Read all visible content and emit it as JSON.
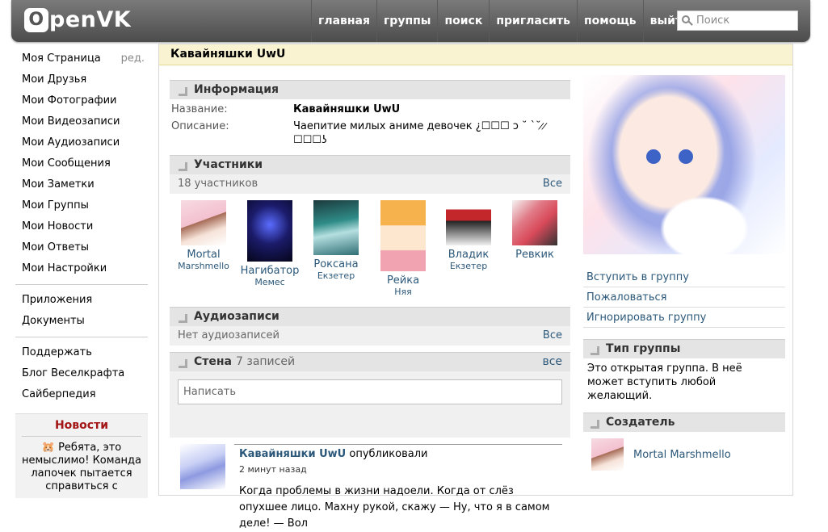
{
  "header": {
    "logo": "penVK",
    "logo_letter": "O",
    "nav": [
      "главная",
      "группы",
      "поиск",
      "пригласить",
      "помощь",
      "выйти"
    ],
    "search_placeholder": "Поиск"
  },
  "sidebar": {
    "items_1": [
      {
        "label": "Моя Страница",
        "edit": "ред."
      },
      {
        "label": "Мои Друзья"
      },
      {
        "label": "Мои Фотографии"
      },
      {
        "label": "Мои Видеозаписи"
      },
      {
        "label": "Мои Аудиозаписи"
      },
      {
        "label": "Мои Сообщения"
      },
      {
        "label": "Мои Заметки"
      },
      {
        "label": "Мои Группы"
      },
      {
        "label": "Мои Новости"
      },
      {
        "label": "Мои Ответы"
      },
      {
        "label": "Мои Настройки"
      }
    ],
    "items_2": [
      "Приложения",
      "Документы"
    ],
    "items_3": [
      "Поддержать",
      "Блог Веселкрафта",
      "Сайберпедия"
    ],
    "news": {
      "title": "Новости",
      "text": "🐹 Ребята, это немыслимо! Команда лапочек пытается справиться с"
    }
  },
  "page": {
    "title": "Кавайняшки UwU"
  },
  "info": {
    "heading": "Информация",
    "name_key": "Название:",
    "name_val": "Кавайняшки UwU",
    "desc_key": "Описание:",
    "desc_val": "Чаепитие милых аниме девочек ¿☐☐☐ ↄ ˘ `˘ ̷ ̷ ☐☐☐ʖ"
  },
  "members": {
    "heading": "Участники",
    "count": "18 участников",
    "all": "Все",
    "list": [
      {
        "first": "Mortal",
        "last": "Marshmello",
        "color": "#f3c8d4"
      },
      {
        "first": "Нагибатор",
        "last": "Мемес",
        "color": "#1b1b6a"
      },
      {
        "first": "Роксана",
        "last": "Екзетер",
        "color": "#2f6f75"
      },
      {
        "first": "Рейка",
        "last": "Няя",
        "color": "#f5c98d"
      },
      {
        "first": "Владик",
        "last": "Екзетер",
        "color": "#c3262b"
      },
      {
        "first": "Ревкик",
        "last": "",
        "color": "#d94a5a"
      }
    ]
  },
  "audio": {
    "heading": "Аудиозаписи",
    "empty": "Нет аудиозаписей",
    "all": "Все"
  },
  "wall": {
    "heading": "Стена",
    "count": "7 записей",
    "all": "все",
    "placeholder": "Написать",
    "post": {
      "author": "Кавайняшки UwU",
      "action": "опубликовали",
      "time": "2 минут назад",
      "text": "Когда проблемы в жизни надоели. Когда от слёз опухшее лицо. Махну рукой, скажу — Ну, что я в самом деле! — Вол"
    }
  },
  "right": {
    "actions": [
      "Вступить в группу",
      "Пожаловаться",
      "Игнорировать группу"
    ],
    "type_heading": "Тип группы",
    "type_text": "Это открытая группа. В неё может вступить любой желающий.",
    "creator_heading": "Создатель",
    "creator_name": "Mortal Marshmello"
  },
  "colors": {
    "link": "#2b587a",
    "header_bg": "#5c5c5c",
    "page_head_bg": "#f9f3d2",
    "section_bg": "#e4e4e4",
    "news_title": "#a31515"
  }
}
